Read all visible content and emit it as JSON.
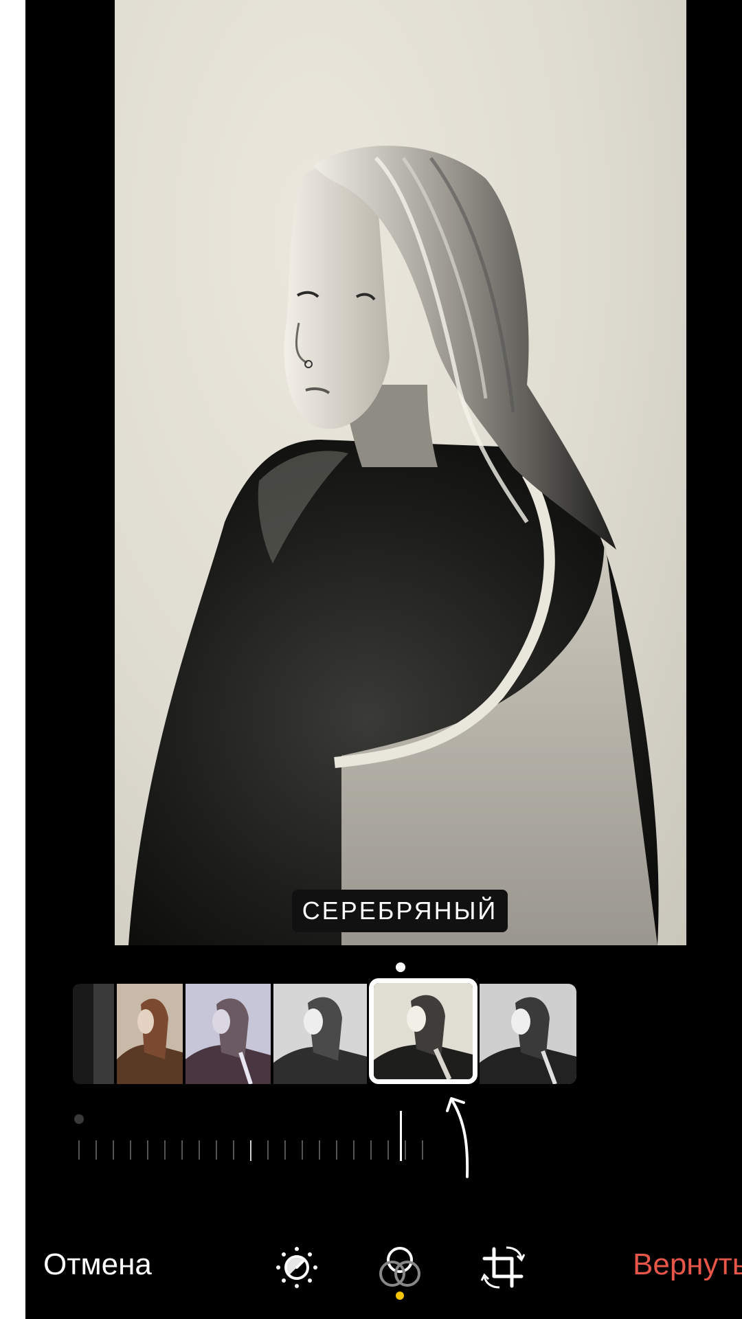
{
  "filter": {
    "current_name": "СЕРЕБРЯНЫЙ",
    "thumbnails": [
      {
        "name": "partial-thumb"
      },
      {
        "name": "warm-thumb"
      },
      {
        "name": "cool-thumb"
      },
      {
        "name": "mono-thumb"
      },
      {
        "name": "silver-thumb"
      },
      {
        "name": "noir-thumb"
      }
    ],
    "selected_index": 4
  },
  "intensity": {
    "tick_count": 21,
    "value_fraction": 1.0
  },
  "toolbar": {
    "cancel_label": "Отмена",
    "revert_label": "Вернуть",
    "icons": [
      "adjust-icon",
      "filters-icon",
      "crop-rotate-icon"
    ],
    "active": "filters-icon"
  },
  "colors": {
    "accent": "#f5c400",
    "destructive": "#e8564a",
    "background": "#000000"
  }
}
